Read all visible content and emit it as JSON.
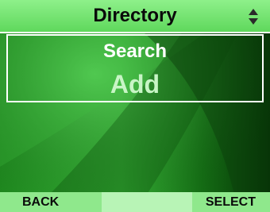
{
  "header": {
    "title": "Directory",
    "scroll_icon": "up-down-arrows-icon"
  },
  "menu": {
    "items": [
      {
        "label": "Search",
        "state": "selected"
      },
      {
        "label": "Add",
        "state": "normal"
      }
    ]
  },
  "softkeys": {
    "left": "BACK",
    "middle": "",
    "right": "SELECT"
  },
  "colors": {
    "header": "#6ee06a",
    "softkey_bar": "#8fe88c",
    "highlight": "#ffffff",
    "item_text": "#c8f5c6"
  }
}
